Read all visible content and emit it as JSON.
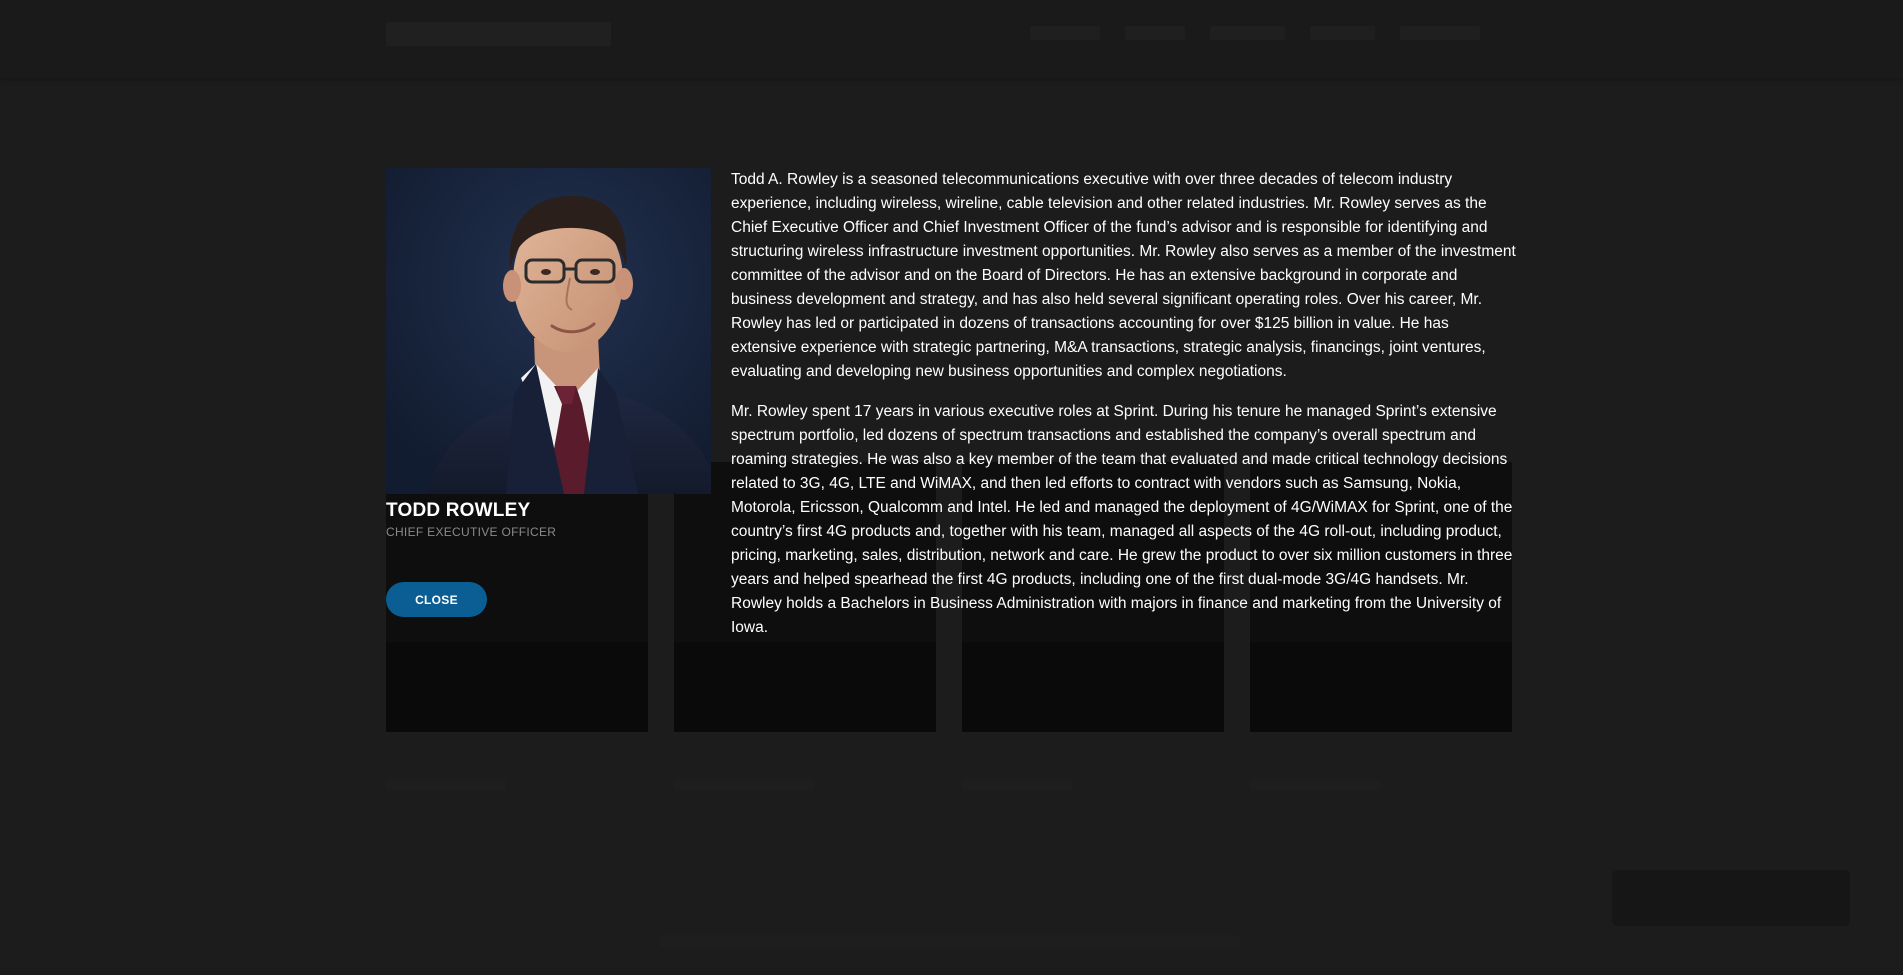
{
  "profile": {
    "name": "TODD ROWLEY",
    "title": "CHIEF EXECUTIVE OFFICER",
    "photo_alt": "Todd Rowley",
    "close_label": "CLOSE",
    "bio": [
      "Todd A. Rowley is a seasoned telecommunications executive with over three decades of telecom industry experience, including wireless, wireline, cable television and other related industries. Mr. Rowley serves as the Chief Executive Officer and Chief Investment Officer of the fund’s advisor and is responsible for identifying and structuring wireless infrastructure investment opportunities. Mr. Rowley also serves as a member of the investment committee of the advisor and on the Board of Directors. He has an extensive background in corporate and business development and strategy, and has also held several significant operating roles. Over his career, Mr. Rowley has led or participated in dozens of transactions accounting for over $125 billion in value. He has extensive experience with strategic partnering, M&A transactions, strategic analysis, financings, joint ventures, evaluating and developing new business opportunities and complex negotiations.",
      "Mr. Rowley spent 17 years in various executive roles at Sprint. During his tenure he managed Sprint’s extensive spectrum portfolio, led dozens of spectrum transactions and established the company’s overall spectrum and roaming strategies. He was also a key member of the team that evaluated and made critical technology decisions related to 3G, 4G, LTE and WiMAX, and then led efforts to contract with vendors such as Samsung, Nokia, Motorola, Ericsson, Qualcomm and Intel. He led and managed the deployment of 4G/WiMAX for Sprint, one of the country’s first 4G products and, together with his team, managed all aspects of the 4G roll-out, including product, pricing, marketing, sales, distribution, network and care. He grew the product to over six million customers in three years and helped spearhead the first 4G products, including one of the first dual-mode 3G/4G handsets. Mr. Rowley holds a Bachelors in Business Administration with majors in finance and marketing from the University of Iowa."
    ]
  },
  "colors": {
    "overlay": "#1b1b1b",
    "close_button": "#0a5e93",
    "text": "#ffffff",
    "subtitle": "#8a8a8a"
  }
}
